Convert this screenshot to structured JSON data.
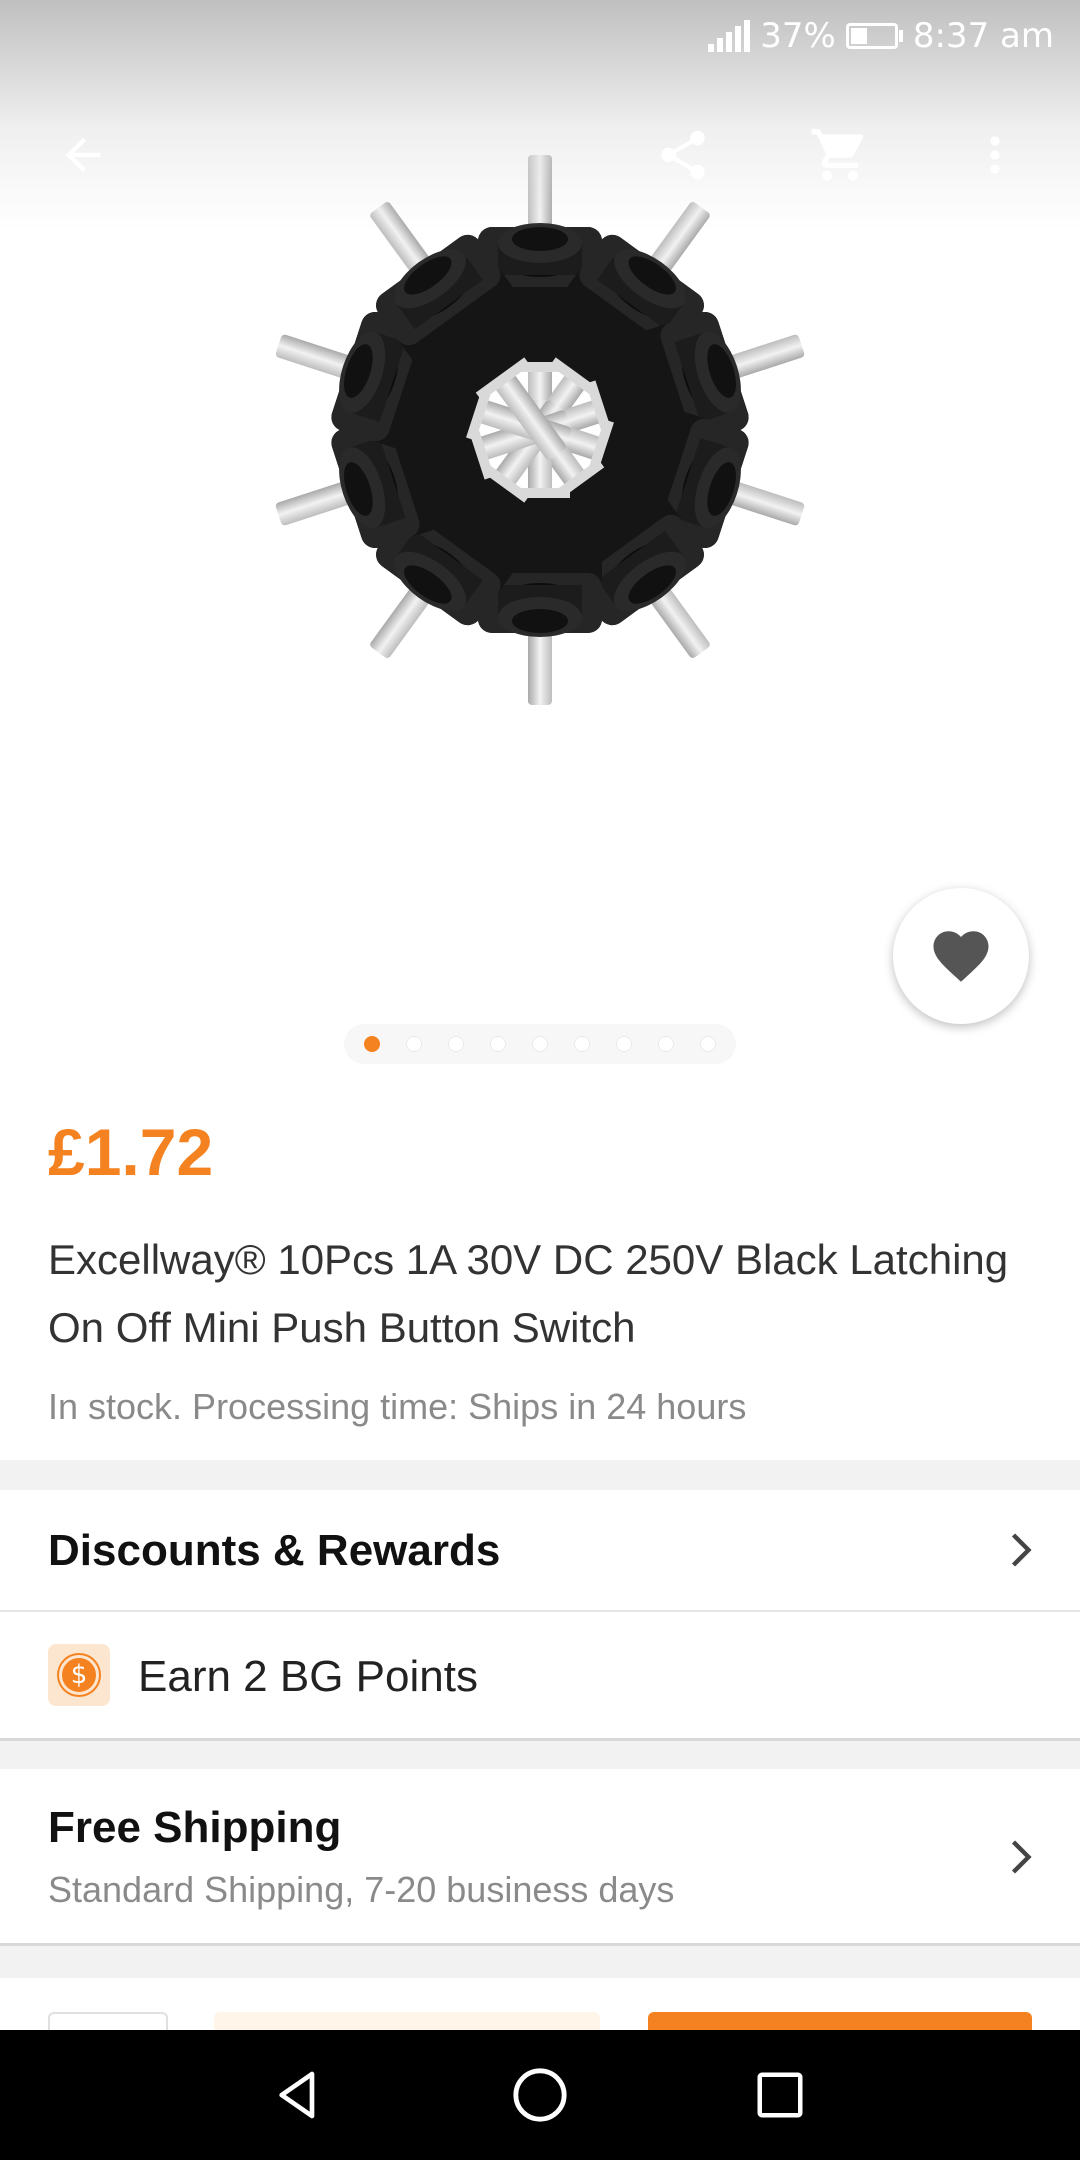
{
  "status_bar": {
    "battery": "37%",
    "time": "8:37 am"
  },
  "toolbar": {
    "back_icon": "arrow-back-icon",
    "share_icon": "share-icon",
    "cart_icon": "cart-icon",
    "more_icon": "more-vert-icon"
  },
  "gallery": {
    "image_count": 9,
    "active_index": 0
  },
  "product": {
    "price": "£1.72",
    "title": "Excellway® 10Pcs 1A 30V DC 250V Black Latching On Off Mini Push Button Switch",
    "stock": "In stock. Processing time: Ships in 24 hours"
  },
  "discounts": {
    "label": "Discounts & Rewards",
    "points_label": "Earn 2 BG Points",
    "points_icon": "$"
  },
  "shipping": {
    "label": "Free Shipping",
    "detail": "Standard Shipping, 7-20 business days"
  },
  "colors": {
    "accent": "#f58220",
    "text_primary": "#222222",
    "text_secondary": "#8a8a8a"
  }
}
